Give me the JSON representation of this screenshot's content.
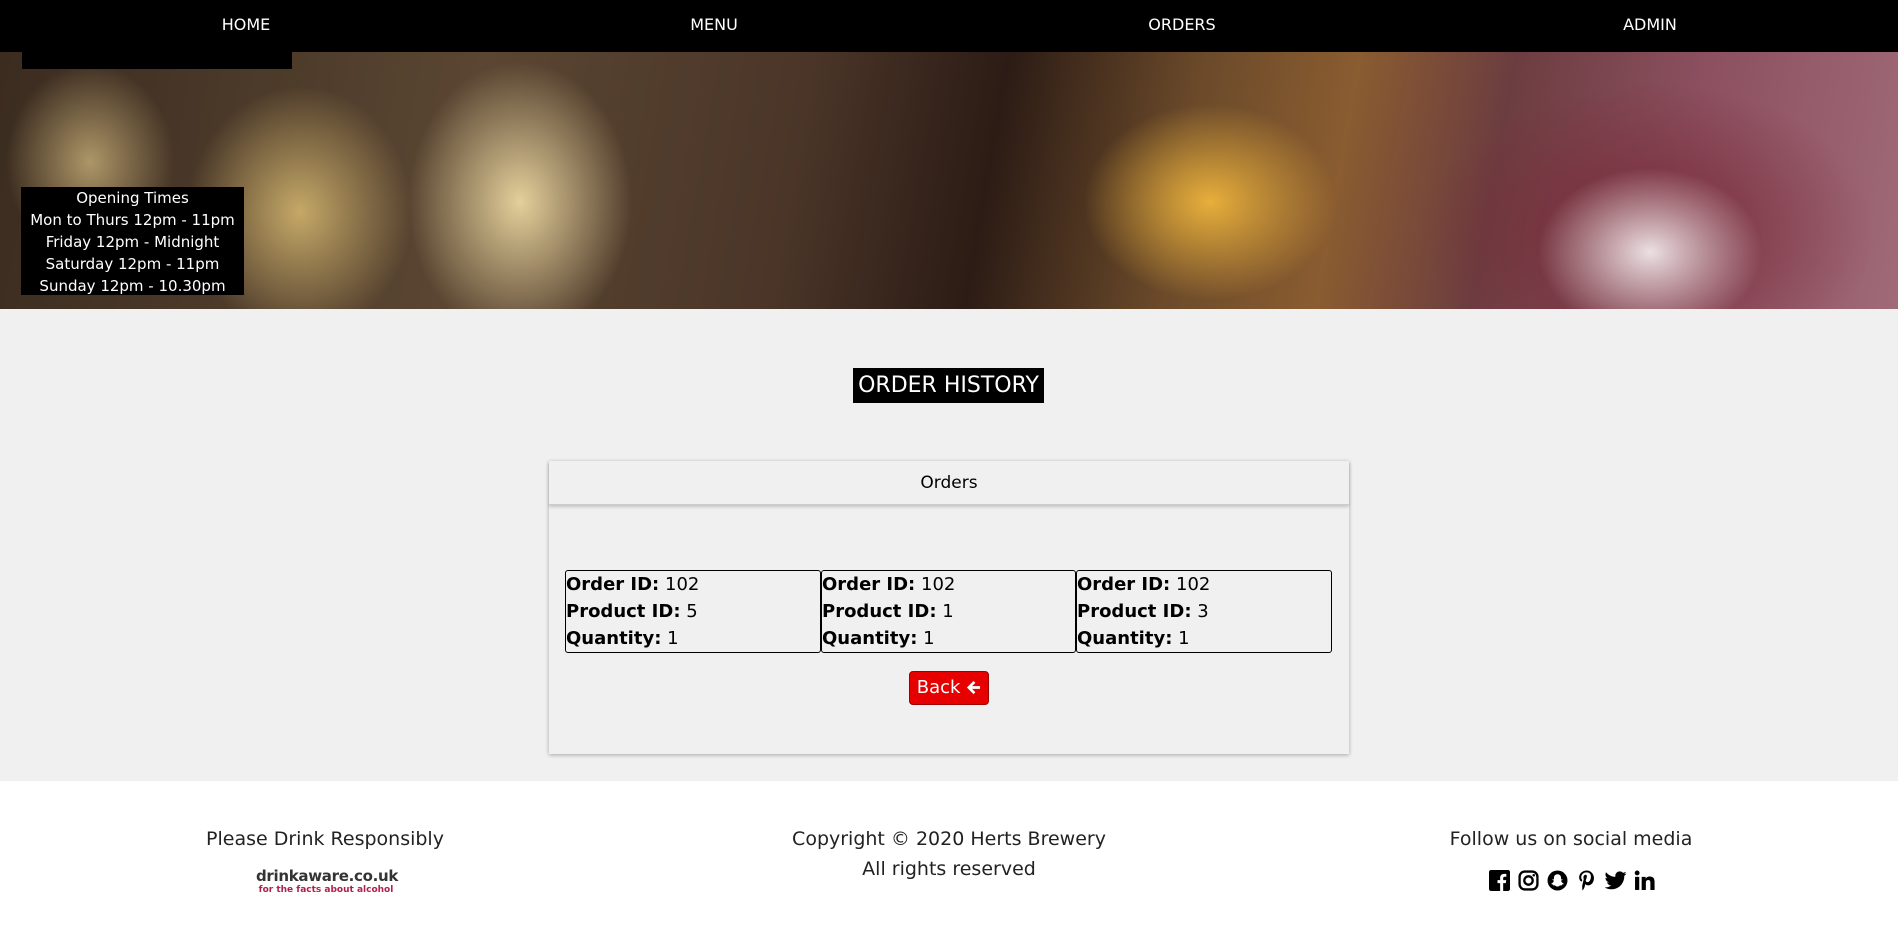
{
  "nav": {
    "items": [
      {
        "label": "HOME"
      },
      {
        "label": "MENU"
      },
      {
        "label": "ORDERS"
      },
      {
        "label": "ADMIN"
      }
    ]
  },
  "hero": {
    "opening": {
      "title": "Opening Times",
      "lines": [
        "Mon to Thurs 12pm - 11pm",
        "Friday 12pm - Midnight",
        "Saturday 12pm - 11pm",
        "Sunday 12pm - 10.30pm"
      ]
    }
  },
  "page": {
    "title": "ORDER HISTORY"
  },
  "orders_card": {
    "header": "Orders",
    "labels": {
      "order_id": "Order ID:",
      "product_id": "Product ID:",
      "quantity": "Quantity:"
    },
    "items": [
      {
        "order_id": "102",
        "product_id": "5",
        "quantity": "1"
      },
      {
        "order_id": "102",
        "product_id": "1",
        "quantity": "1"
      },
      {
        "order_id": "102",
        "product_id": "3",
        "quantity": "1"
      }
    ],
    "back_label": "Back"
  },
  "footer": {
    "left_text": "Please Drink Responsibly",
    "drinkaware_brand": "drinkaware.co.uk",
    "drinkaware_tag": "for the facts about alcohol",
    "copyright": "Copyright © 2020 Herts Brewery",
    "rights": "All rights reserved",
    "social_text": "Follow us on social media",
    "social_icons": [
      "facebook-icon",
      "instagram-icon",
      "snapchat-icon",
      "pinterest-icon",
      "twitter-icon",
      "linkedin-icon"
    ]
  }
}
